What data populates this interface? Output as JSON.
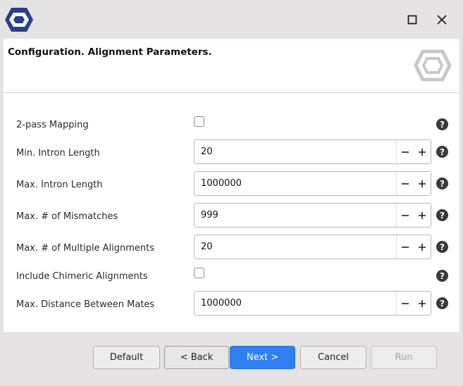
{
  "header": {
    "title": "Configuration. Alignment Parameters."
  },
  "params": [
    {
      "label": "2-pass Mapping",
      "type": "checkbox",
      "checked": false
    },
    {
      "label": "Min. Intron Length",
      "type": "spin",
      "value": "20"
    },
    {
      "label": "Max. Intron Length",
      "type": "spin",
      "value": "1000000"
    },
    {
      "label": "Max. # of Mismatches",
      "type": "spin",
      "value": "999"
    },
    {
      "label": "Max. # of Multiple Alignments",
      "type": "spin",
      "value": "20"
    },
    {
      "label": "Include Chimeric Alignments",
      "type": "checkbox",
      "checked": false
    },
    {
      "label": "Max. Distance Between Mates",
      "type": "spin",
      "value": "1000000"
    }
  ],
  "footer": {
    "default_label": "Default",
    "back_label": "< Back",
    "next_label": "Next >",
    "cancel_label": "Cancel",
    "run_label": "Run"
  },
  "colors": {
    "accent": "#2f7ff0",
    "logo_blue": "#2b3f8f",
    "logo_gray": "#c8c8c8"
  }
}
